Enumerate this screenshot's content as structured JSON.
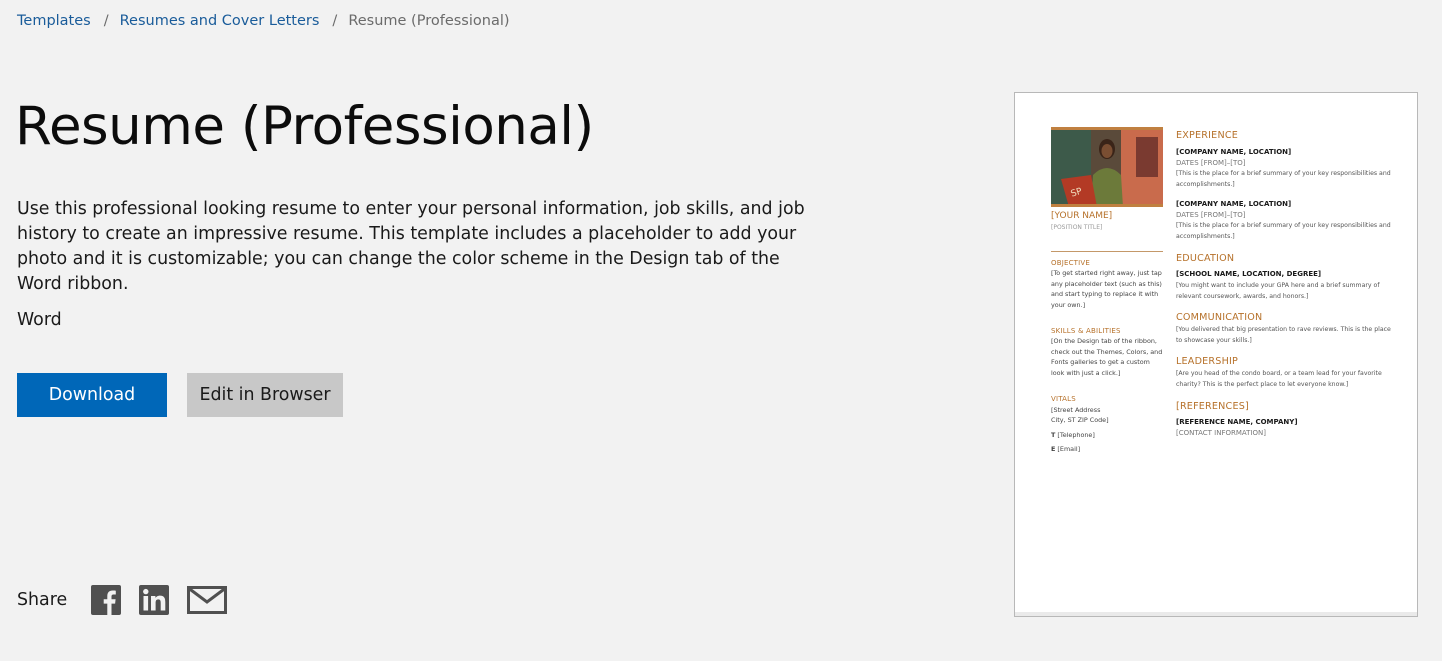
{
  "breadcrumb": {
    "items": [
      "Templates",
      "Resumes and Cover Letters"
    ],
    "current": "Resume (Professional)",
    "separator": "/"
  },
  "page": {
    "title": "Resume (Professional)",
    "description": "Use this professional looking resume to enter your personal information, job skills, and job history to create an impressive resume. This template includes a placeholder to add your photo and it is customizable; you can change the color scheme in the Design tab of the Word ribbon.",
    "app": "Word"
  },
  "actions": {
    "download": "Download",
    "edit": "Edit in Browser"
  },
  "share": {
    "label": "Share",
    "icons": [
      "facebook-icon",
      "linkedin-icon",
      "email-icon"
    ]
  },
  "colors": {
    "link": "#1a5c9a",
    "primary": "#0067b8",
    "secondary": "#c8c8c8",
    "accent": "#b6712a",
    "background": "#f2f2f2"
  },
  "preview": {
    "name": "[YOUR NAME]",
    "position": "[POSITION TITLE]",
    "objective": {
      "heading": "OBJECTIVE",
      "text": "[To get started right away, just tap any placeholder text (such as this) and start typing to replace it with your own.]"
    },
    "skills": {
      "heading": "SKILLS & ABILITIES",
      "text": "[On the Design tab of the ribbon, check out the Themes, Colors, and Fonts galleries to get a custom look with just a click.]"
    },
    "vitals": {
      "heading": "VITALS",
      "address1": "[Street Address",
      "address2": "City, ST ZIP Code]",
      "phone_label": "T",
      "phone": "[Telephone]",
      "email_label": "E",
      "email": "[Email]"
    },
    "experience": {
      "heading": "EXPERIENCE",
      "jobs": [
        {
          "company": "[COMPANY NAME, LOCATION]",
          "dates": "DATES [FROM]–[TO]",
          "summary": "[This is the place for a brief summary of your key responsibilities and accomplishments.]"
        },
        {
          "company": "[COMPANY NAME, LOCATION]",
          "dates": "DATES [FROM]–[TO]",
          "summary": "[This is the place for a brief summary of your key responsibilities and accomplishments.]"
        }
      ]
    },
    "education": {
      "heading": "EDUCATION",
      "school": "[SCHOOL NAME, LOCATION, DEGREE]",
      "text": "[You might want to include your GPA here and a brief summary of relevant coursework, awards, and honors.]"
    },
    "communication": {
      "heading": "COMMUNICATION",
      "text": "[You delivered that big presentation to rave reviews. This is the place to showcase your skills.]"
    },
    "leadership": {
      "heading": "LEADERSHIP",
      "text": "[Are you head of the condo board, or a team lead for your favorite charity? This is the perfect place to let everyone know.]"
    },
    "references": {
      "heading": "[REFERENCES]",
      "name": "[REFERENCE NAME, COMPANY]",
      "contact": "[CONTACT INFORMATION]"
    }
  }
}
